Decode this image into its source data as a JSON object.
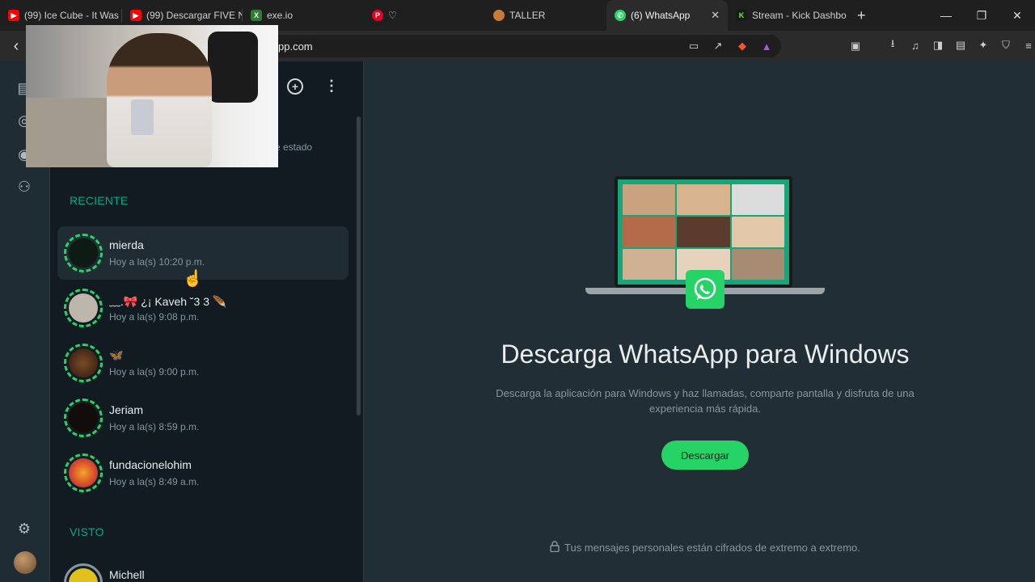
{
  "browser": {
    "tabs": [
      {
        "title": "(99) Ice Cube - It Was",
        "favicon": "youtube-icon",
        "color": "#ff0000"
      },
      {
        "title": "(99) Descargar FIVE N",
        "favicon": "youtube-icon",
        "color": "#ff0000"
      },
      {
        "title": "exe.io",
        "favicon": "exeio-icon",
        "color": "#4caf50"
      },
      {
        "title": "",
        "favicon": "pinterest-icon",
        "color": "#e60023",
        "extra": "♡"
      },
      {
        "title": "TALLER",
        "favicon": "taller-icon",
        "color": "#c77a3a"
      },
      {
        "title": "(6) WhatsApp",
        "favicon": "whatsapp-icon",
        "color": "#25d366",
        "active": true
      },
      {
        "title": "Stream - Kick Dashbo",
        "favicon": "kick-icon",
        "color": "#53fc18"
      }
    ],
    "url": "pp.com"
  },
  "status_panel": {
    "hint_text": "e estado",
    "recent_title": "RECIENTE",
    "seen_title": "VISTO",
    "recent": [
      {
        "name": "mierda",
        "time": "Hoy a la(s) 10:20 p.m.",
        "pic": "#0e1a14"
      },
      {
        "name": "﹏.🎀 ¿¡ Kaveh ˘3 3 🪶",
        "time": "Hoy a la(s) 9:08 p.m.",
        "pic": "#bdb6ad"
      },
      {
        "name": "🦋",
        "time": "Hoy a la(s) 9:00 p.m.",
        "pic": "#4a2a1a"
      },
      {
        "name": "Jeriam",
        "time": "Hoy a la(s) 8:59 p.m.",
        "pic": "#120c0a"
      },
      {
        "name": "fundacionelohim",
        "time": "Hoy a la(s) 8:49 a.m.",
        "pic": "#d8452b"
      }
    ],
    "seen": [
      {
        "name": "Michell",
        "pic": "#e0c21a"
      }
    ]
  },
  "main": {
    "headline": "Descarga WhatsApp para Windows",
    "subtext": "Descarga la aplicación para Windows y haz llamadas, comparte pantalla y disfruta de una experiencia más rápida.",
    "download_label": "Descargar",
    "e2e_text": "Tus mensajes personales están cifrados de extremo a extremo."
  },
  "colors": {
    "accent": "#25d366",
    "accent_dark": "#00a884",
    "background": "#111b21",
    "panel": "#222e35"
  }
}
